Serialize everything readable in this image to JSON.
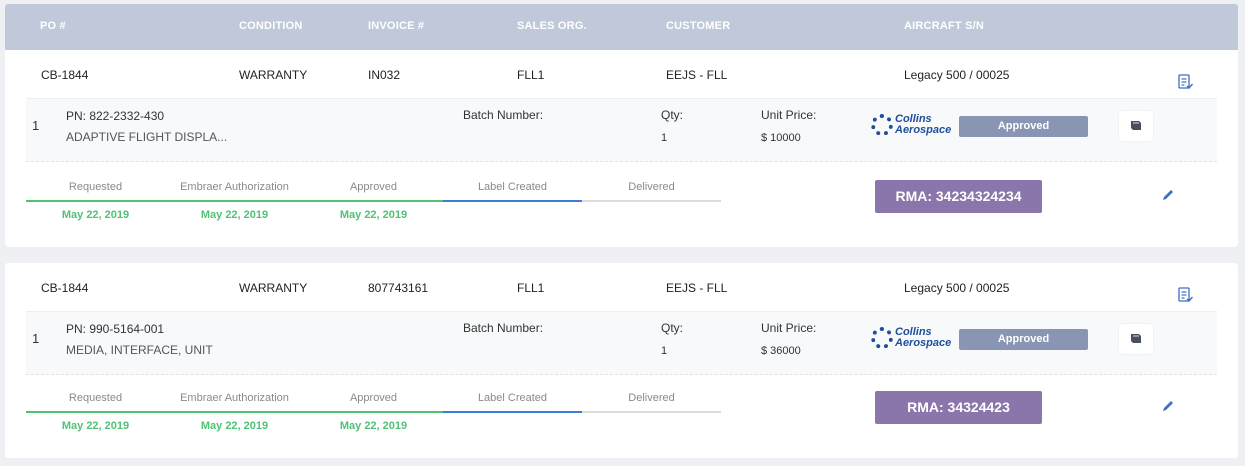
{
  "header": {
    "po": "PO #",
    "condition": "CONDITION",
    "invoice": "INVOICE #",
    "sales_org": "SALES ORG.",
    "customer": "CUSTOMER",
    "aircraft": "AIRCRAFT S/N"
  },
  "labels": {
    "batch": "Batch Number:",
    "qty": "Qty:",
    "unit_price": "Unit Price:",
    "logo_line1": "Collins",
    "logo_line2": "Aerospace"
  },
  "colors": {
    "header_bg": "#bfc9d9",
    "approved_badge": "#8a95b4",
    "rma_button": "#8b76ac",
    "progress_done": "#4fc276",
    "progress_current": "#3b7ddd",
    "progress_pending": "#dcdcdc",
    "brand_blue": "#1f4e9c"
  },
  "steps": [
    "Requested",
    "Embraer Authorization",
    "Approved",
    "Label Created",
    "Delivered"
  ],
  "orders": [
    {
      "po": "CB-1844",
      "condition": "WARRANTY",
      "invoice": "IN032",
      "sales_org": "FLL1",
      "customer": "EEJS - FLL",
      "aircraft": "Legacy 500 / 00025",
      "item": {
        "line": "1",
        "pn": "PN: 822-2332-430",
        "description": "ADAPTIVE FLIGHT DISPLA...",
        "qty": "1",
        "unit_price": "$ 10000",
        "status": "Approved"
      },
      "dates": [
        "May 22, 2019",
        "May 22, 2019",
        "May 22, 2019"
      ],
      "rma": "RMA: 34234324234"
    },
    {
      "po": "CB-1844",
      "condition": "WARRANTY",
      "invoice": "807743161",
      "sales_org": "FLL1",
      "customer": "EEJS - FLL",
      "aircraft": "Legacy 500 / 00025",
      "item": {
        "line": "1",
        "pn": "PN: 990-5164-001",
        "description": "MEDIA, INTERFACE, UNIT",
        "qty": "1",
        "unit_price": "$ 36000",
        "status": "Approved"
      },
      "dates": [
        "May 22, 2019",
        "May 22, 2019",
        "May 22, 2019"
      ],
      "rma": "RMA: 34324423"
    }
  ]
}
